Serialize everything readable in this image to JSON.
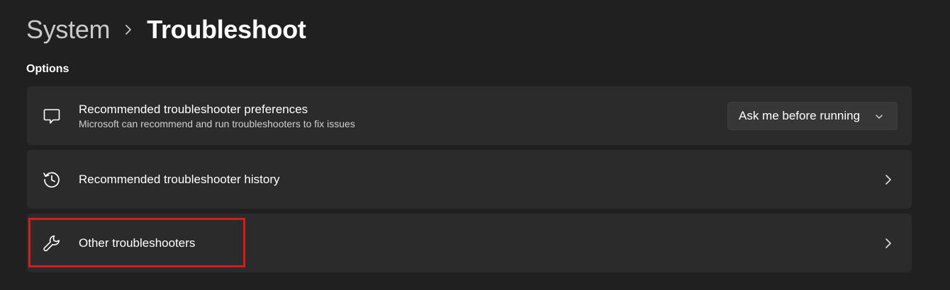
{
  "breadcrumb": {
    "parent": "System",
    "current": "Troubleshoot"
  },
  "section": {
    "title": "Options"
  },
  "items": [
    {
      "title": "Recommended troubleshooter preferences",
      "description": "Microsoft can recommend and run troubleshooters to fix issues",
      "icon": "chat-bubble-icon",
      "dropdown_value": "Ask me before running"
    },
    {
      "title": "Recommended troubleshooter history",
      "icon": "history-icon"
    },
    {
      "title": "Other troubleshooters",
      "icon": "wrench-icon",
      "highlighted": true
    }
  ],
  "colors": {
    "background": "#202020",
    "card": "#2b2b2b",
    "highlight": "#d51d1d"
  }
}
